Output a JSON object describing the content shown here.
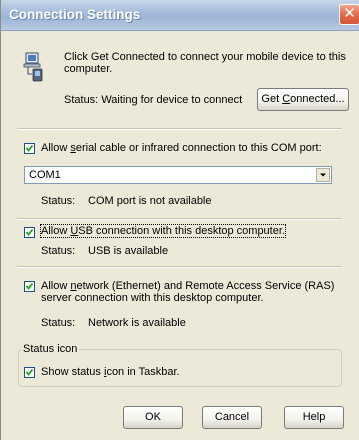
{
  "window": {
    "title": "Connection Settings",
    "close_glyph": "✕"
  },
  "connect": {
    "description_line1": "Click Get Connected to connect your mobile device to this",
    "description_line2": "computer.",
    "status_label": "Status:",
    "status_value": "Waiting for device to connect",
    "button_pre": "Get ",
    "button_mnemonic": "C",
    "button_post": "onnected..."
  },
  "serial": {
    "checked": true,
    "label_pre": "Allow ",
    "label_mnemonic": "s",
    "label_post": "erial cable or infrared connection to this COM port:",
    "port_value": "COM1",
    "status_label": "Status:",
    "status_value": "COM port is not available"
  },
  "usb": {
    "checked": true,
    "label_pre": "Allow ",
    "label_mnemonic": "U",
    "label_post": "SB connection with this desktop computer.",
    "status_label": "Status:",
    "status_value": "USB is available"
  },
  "network": {
    "checked": true,
    "line1_pre": "Allow ",
    "line1_mnemonic": "n",
    "line1_post": "etwork (Ethernet) and Remote Access Service (RAS)",
    "line2": "server connection with this desktop computer.",
    "status_label": "Status:",
    "status_value": "Network is available"
  },
  "status_icon_group": {
    "title": "Status icon",
    "checked": true,
    "label_pre": "Show status ",
    "label_mnemonic": "i",
    "label_post": "con in Taskbar."
  },
  "buttons": {
    "ok": "OK",
    "cancel": "Cancel",
    "help": "Help"
  },
  "icons": {
    "device": "pda-computer-icon",
    "checkmark": "checkmark-icon",
    "dropdown": "chevron-down-icon",
    "close": "close-icon"
  },
  "colors": {
    "dialog_bg": "#ece9d8",
    "title_bg": "#a9bfdc",
    "close_red": "#e06845",
    "checkbox_border": "#1c5180"
  }
}
